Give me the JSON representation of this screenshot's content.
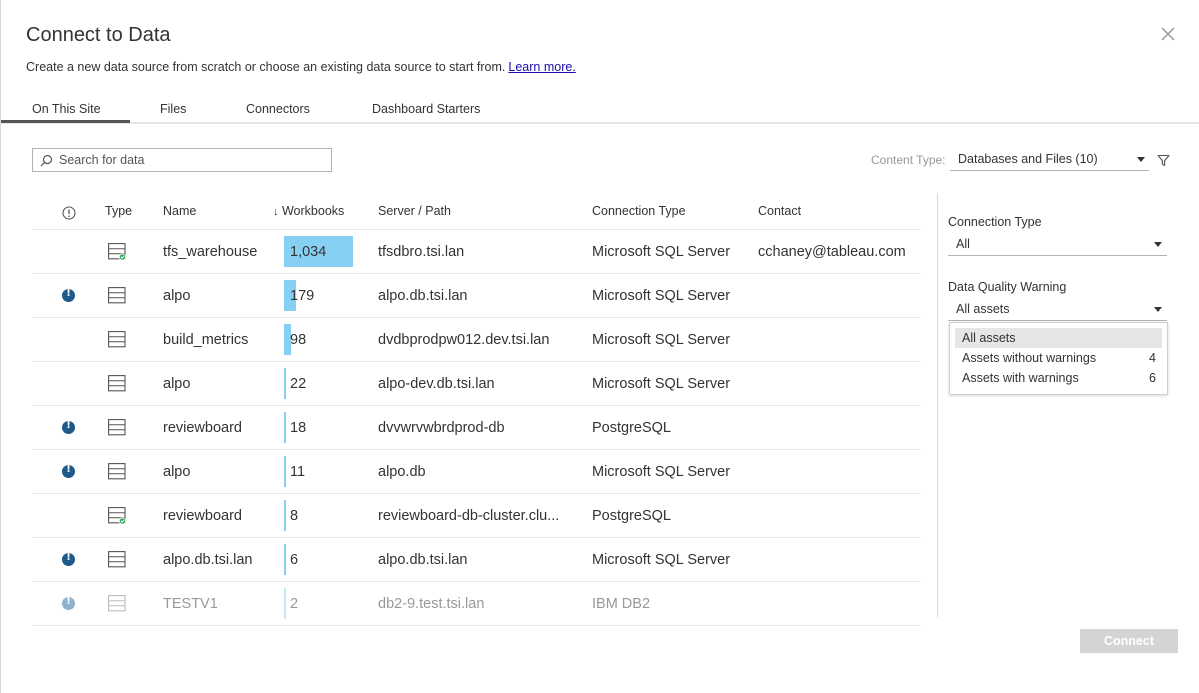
{
  "dialog": {
    "title": "Connect to Data",
    "subtitle": "Create a new data source from scratch or choose an existing data source to start from.",
    "learn_more": "Learn more.",
    "close_icon": "close-icon"
  },
  "tabs": [
    {
      "label": "On This Site",
      "active": true
    },
    {
      "label": "Files",
      "active": false
    },
    {
      "label": "Connectors",
      "active": false
    },
    {
      "label": "Dashboard Starters",
      "active": false
    }
  ],
  "search": {
    "placeholder": "Search for data",
    "value": ""
  },
  "content_type": {
    "label": "Content Type:",
    "value": "Databases and Files (10)"
  },
  "table": {
    "columns": {
      "warning": "warning-icon",
      "type": "Type",
      "name": "Name",
      "workbooks": "Workbooks",
      "sort_indicator": "↓",
      "server": "Server / Path",
      "connection": "Connection Type",
      "contact": "Contact"
    },
    "max_workbooks": 1034,
    "rows": [
      {
        "name": "tfs_warehouse",
        "workbooks": "1,034",
        "workbooks_value": 1034,
        "server": "tfsdbro.tsi.lan",
        "connection": "Microsoft SQL Server",
        "contact": "cchaney@tableau.com",
        "warning": false,
        "certified": true,
        "dim": false
      },
      {
        "name": "alpo",
        "workbooks": "179",
        "workbooks_value": 179,
        "server": "alpo.db.tsi.lan",
        "connection": "Microsoft SQL Server",
        "contact": "",
        "warning": true,
        "certified": false,
        "dim": false
      },
      {
        "name": "build_metrics",
        "workbooks": "98",
        "workbooks_value": 98,
        "server": "dvdbprodpw012.dev.tsi.lan",
        "connection": "Microsoft SQL Server",
        "contact": "",
        "warning": false,
        "certified": false,
        "dim": false
      },
      {
        "name": "alpo",
        "workbooks": "22",
        "workbooks_value": 22,
        "server": "alpo-dev.db.tsi.lan",
        "connection": "Microsoft SQL Server",
        "contact": "",
        "warning": false,
        "certified": false,
        "dim": false
      },
      {
        "name": "reviewboard",
        "workbooks": "18",
        "workbooks_value": 18,
        "server": "dvvwrvwbrdprod-db",
        "connection": "PostgreSQL",
        "contact": "",
        "warning": true,
        "certified": false,
        "dim": false
      },
      {
        "name": "alpo",
        "workbooks": "11",
        "workbooks_value": 11,
        "server": "alpo.db",
        "connection": "Microsoft SQL Server",
        "contact": "",
        "warning": true,
        "certified": false,
        "dim": false
      },
      {
        "name": "reviewboard",
        "workbooks": "8",
        "workbooks_value": 8,
        "server": "reviewboard-db-cluster.clu...",
        "connection": "PostgreSQL",
        "contact": "",
        "warning": false,
        "certified": true,
        "dim": false
      },
      {
        "name": "alpo.db.tsi.lan",
        "workbooks": "6",
        "workbooks_value": 6,
        "server": "alpo.db.tsi.lan",
        "connection": "Microsoft SQL Server",
        "contact": "",
        "warning": true,
        "certified": false,
        "dim": false
      },
      {
        "name": "TESTV1",
        "workbooks": "2",
        "workbooks_value": 2,
        "server": "db2-9.test.tsi.lan",
        "connection": "IBM DB2",
        "contact": "",
        "warning": true,
        "certified": false,
        "dim": true
      }
    ]
  },
  "filters": {
    "connection_type": {
      "label": "Connection Type",
      "value": "All"
    },
    "data_quality": {
      "label": "Data Quality Warning",
      "value": "All assets",
      "options": [
        {
          "label": "All assets",
          "count": "",
          "selected": true
        },
        {
          "label": "Assets without warnings",
          "count": "4",
          "selected": false
        },
        {
          "label": "Assets with warnings",
          "count": "6",
          "selected": false
        }
      ]
    }
  },
  "connect_button": "Connect",
  "colors": {
    "bar": "#86d0f3",
    "warning": "#1f5a8a",
    "certified": "#3aaa58"
  }
}
